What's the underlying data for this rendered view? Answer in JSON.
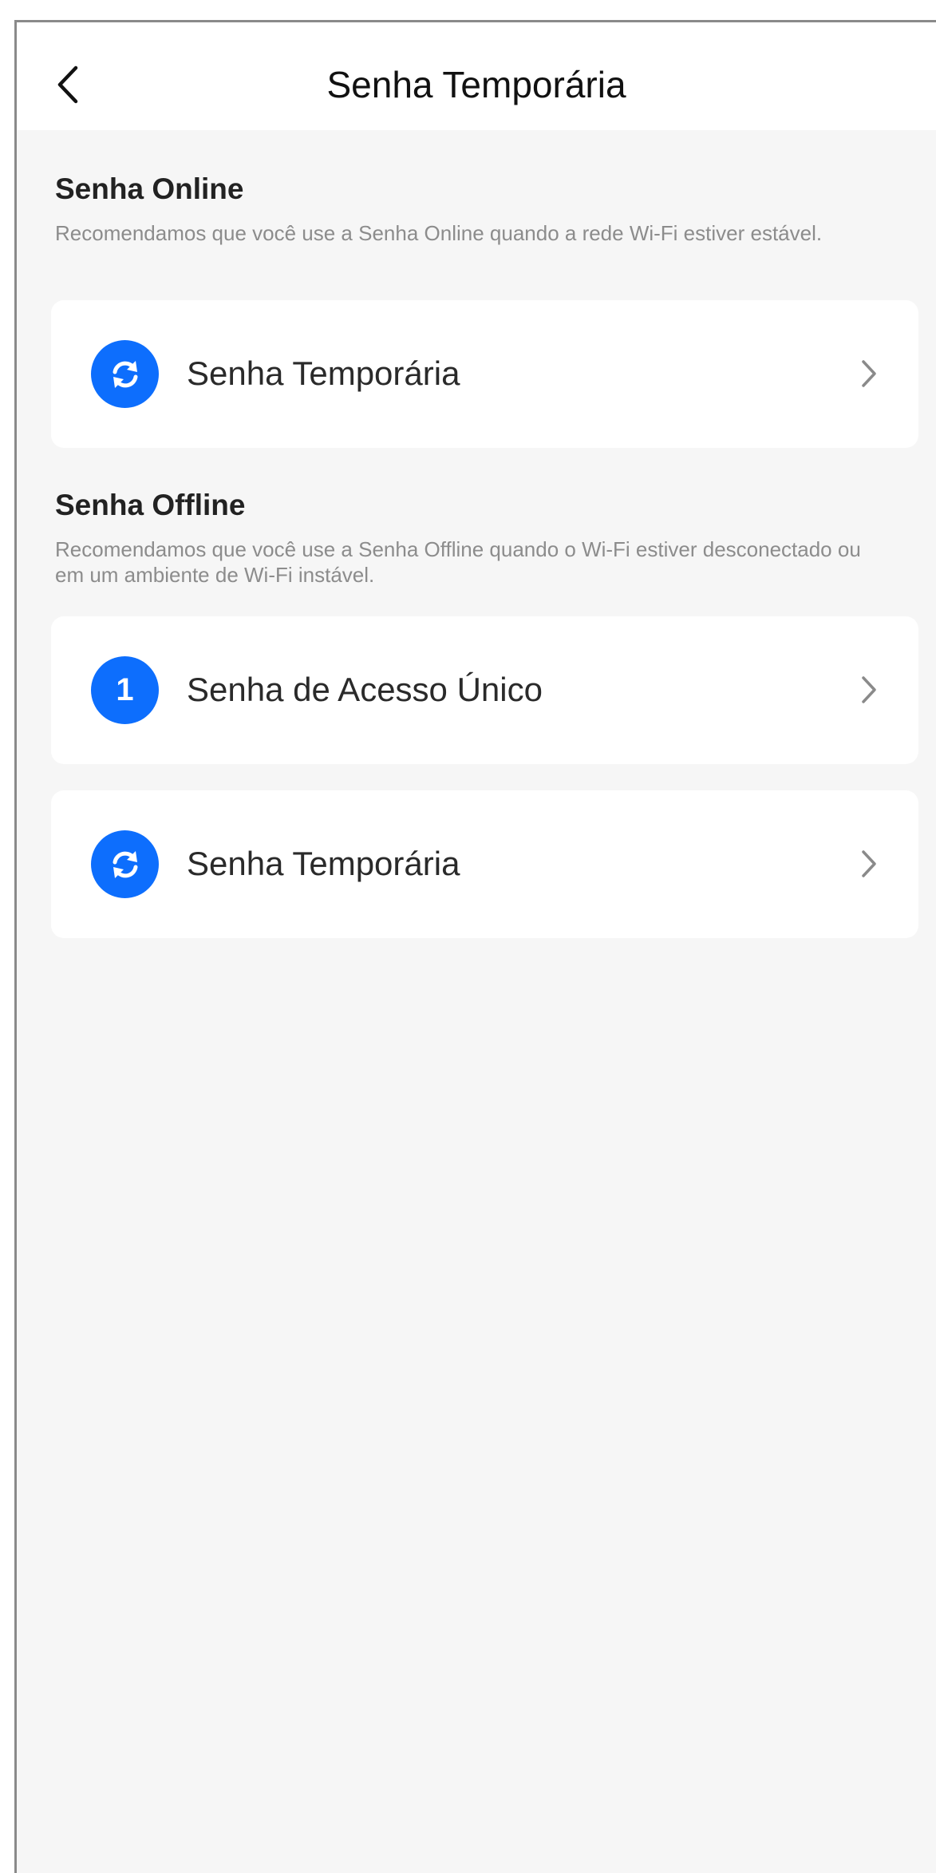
{
  "header": {
    "title": "Senha Temporária",
    "back_icon": "chevron-left-icon"
  },
  "sections": [
    {
      "title": "Senha Online",
      "description": "Recomendamos que você use a Senha Online quando a rede Wi-Fi estiver estável.",
      "items": [
        {
          "label": "Senha Temporária",
          "icon": "refresh-icon"
        }
      ]
    },
    {
      "title": "Senha Offline",
      "description": "Recomendamos que você use a Senha Offline quando o Wi-Fi estiver desconectado ou em um ambiente de Wi-Fi instável.",
      "items": [
        {
          "label": "Senha de Acesso Único",
          "icon": "number-one-icon",
          "icon_text": "1"
        },
        {
          "label": "Senha Temporária",
          "icon": "refresh-icon"
        }
      ]
    }
  ],
  "colors": {
    "accent": "#0d6efd",
    "background": "#f6f6f6",
    "card": "#ffffff",
    "title_text": "#222222",
    "description_text": "#8c8c8c"
  }
}
